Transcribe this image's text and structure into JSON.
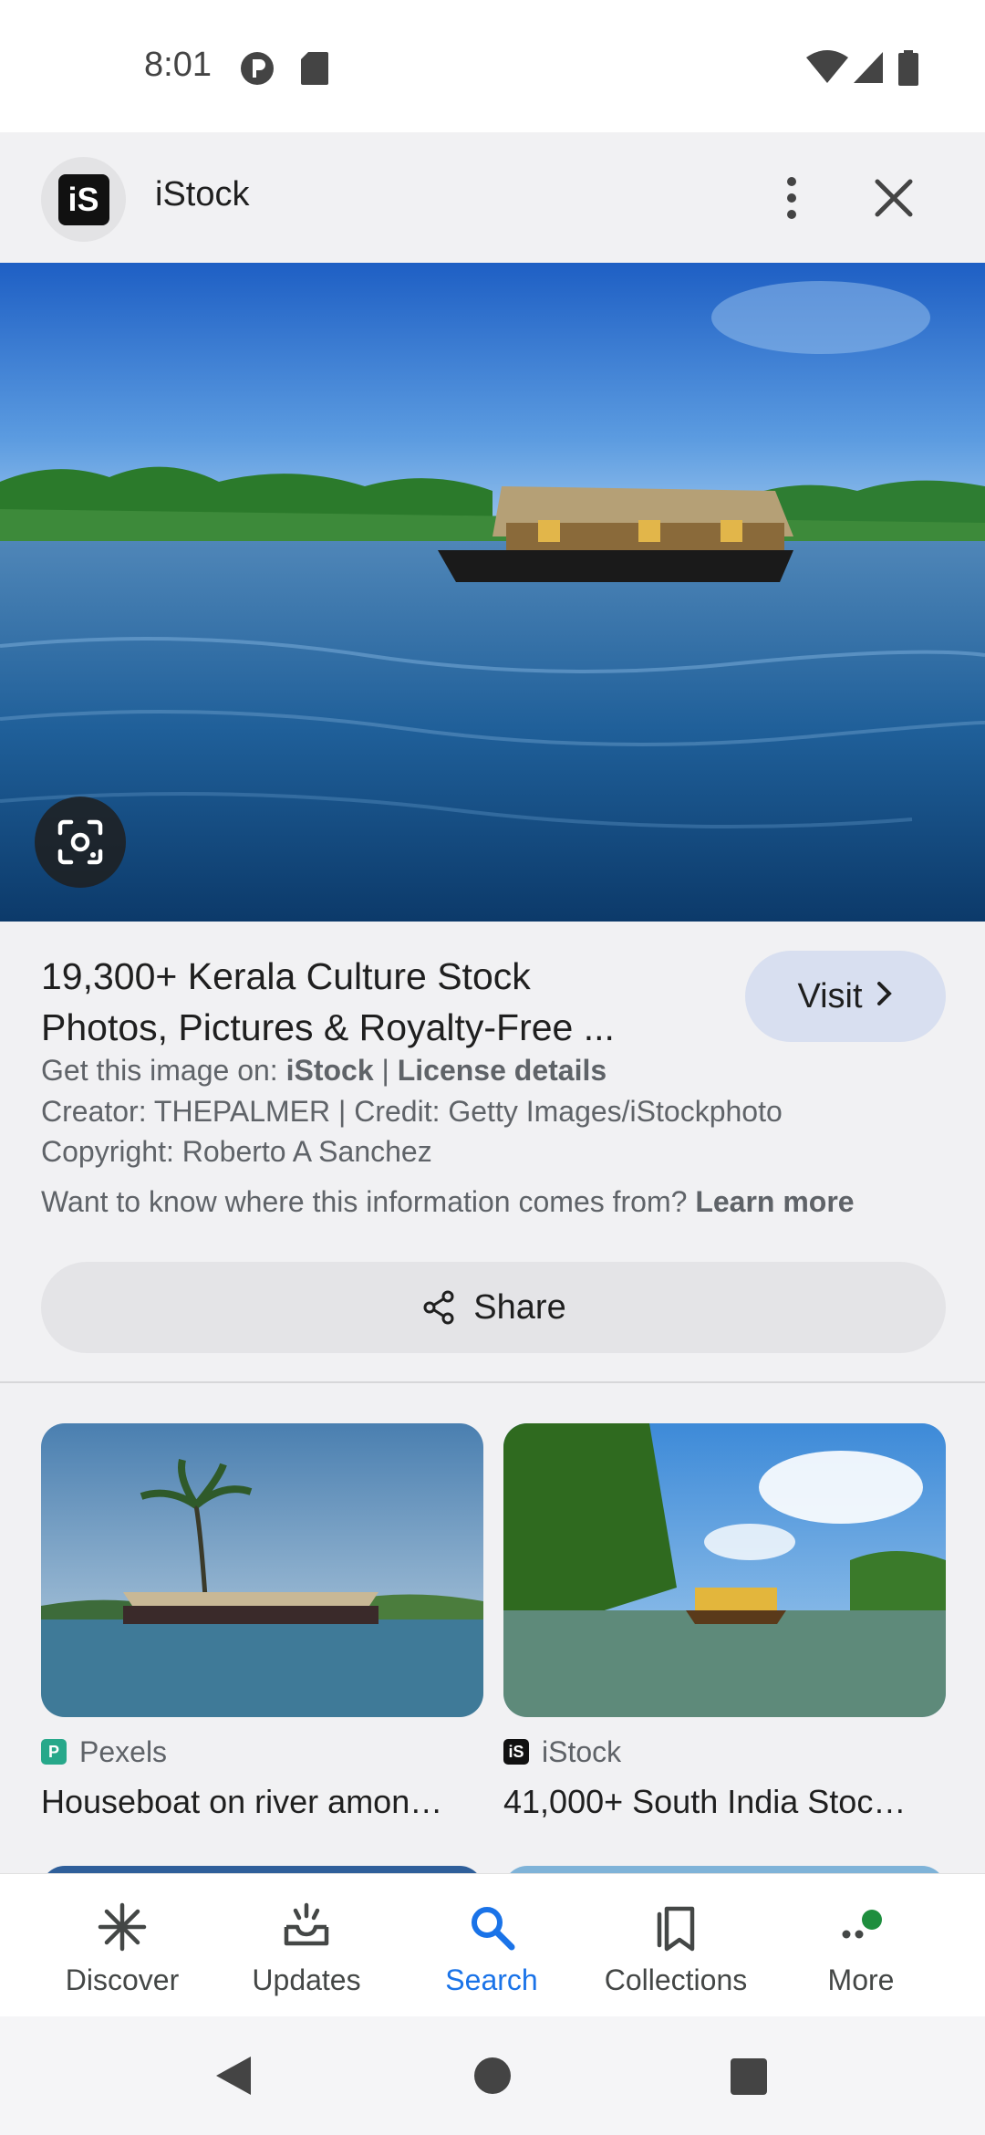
{
  "status_bar": {
    "time": "8:01"
  },
  "header": {
    "site_name": "iStock",
    "logo_text": "iS",
    "icons": [
      "more-vert-icon",
      "close-icon"
    ]
  },
  "result": {
    "title_line1": "19,300+ Kerala Culture Stock",
    "title_line2": "Photos, Pictures & Royalty-Free ...",
    "visit_label": "Visit",
    "get_image_prefix": "Get this image on: ",
    "get_image_site": "iStock",
    "separator": " | ",
    "license_label": "License details",
    "creator_line": "Creator: THEPALMER | Credit: Getty Images/iStockphoto",
    "copyright_line": "Copyright: Roberto A Sanchez",
    "info_question": "Want to know where this information comes from? ",
    "learn_more": "Learn more",
    "share_label": "Share"
  },
  "related": [
    {
      "source": "Pexels",
      "title": "Houseboat on river amon…"
    },
    {
      "source": "iStock",
      "title": "41,000+ South India Stoc…"
    }
  ],
  "bottom_nav": {
    "items": [
      {
        "label": "Discover",
        "icon": "asterisk-icon"
      },
      {
        "label": "Updates",
        "icon": "updates-tray-icon"
      },
      {
        "label": "Search",
        "icon": "search-icon",
        "active": true
      },
      {
        "label": "Collections",
        "icon": "bookmarks-icon"
      },
      {
        "label": "More",
        "icon": "more-dots-icon"
      }
    ]
  },
  "colors": {
    "accent": "#1a73e8",
    "visit_bg": "#d8dff0",
    "sheet_bg": "#f1f1f3",
    "notification_dot": "#1e8e3e"
  }
}
